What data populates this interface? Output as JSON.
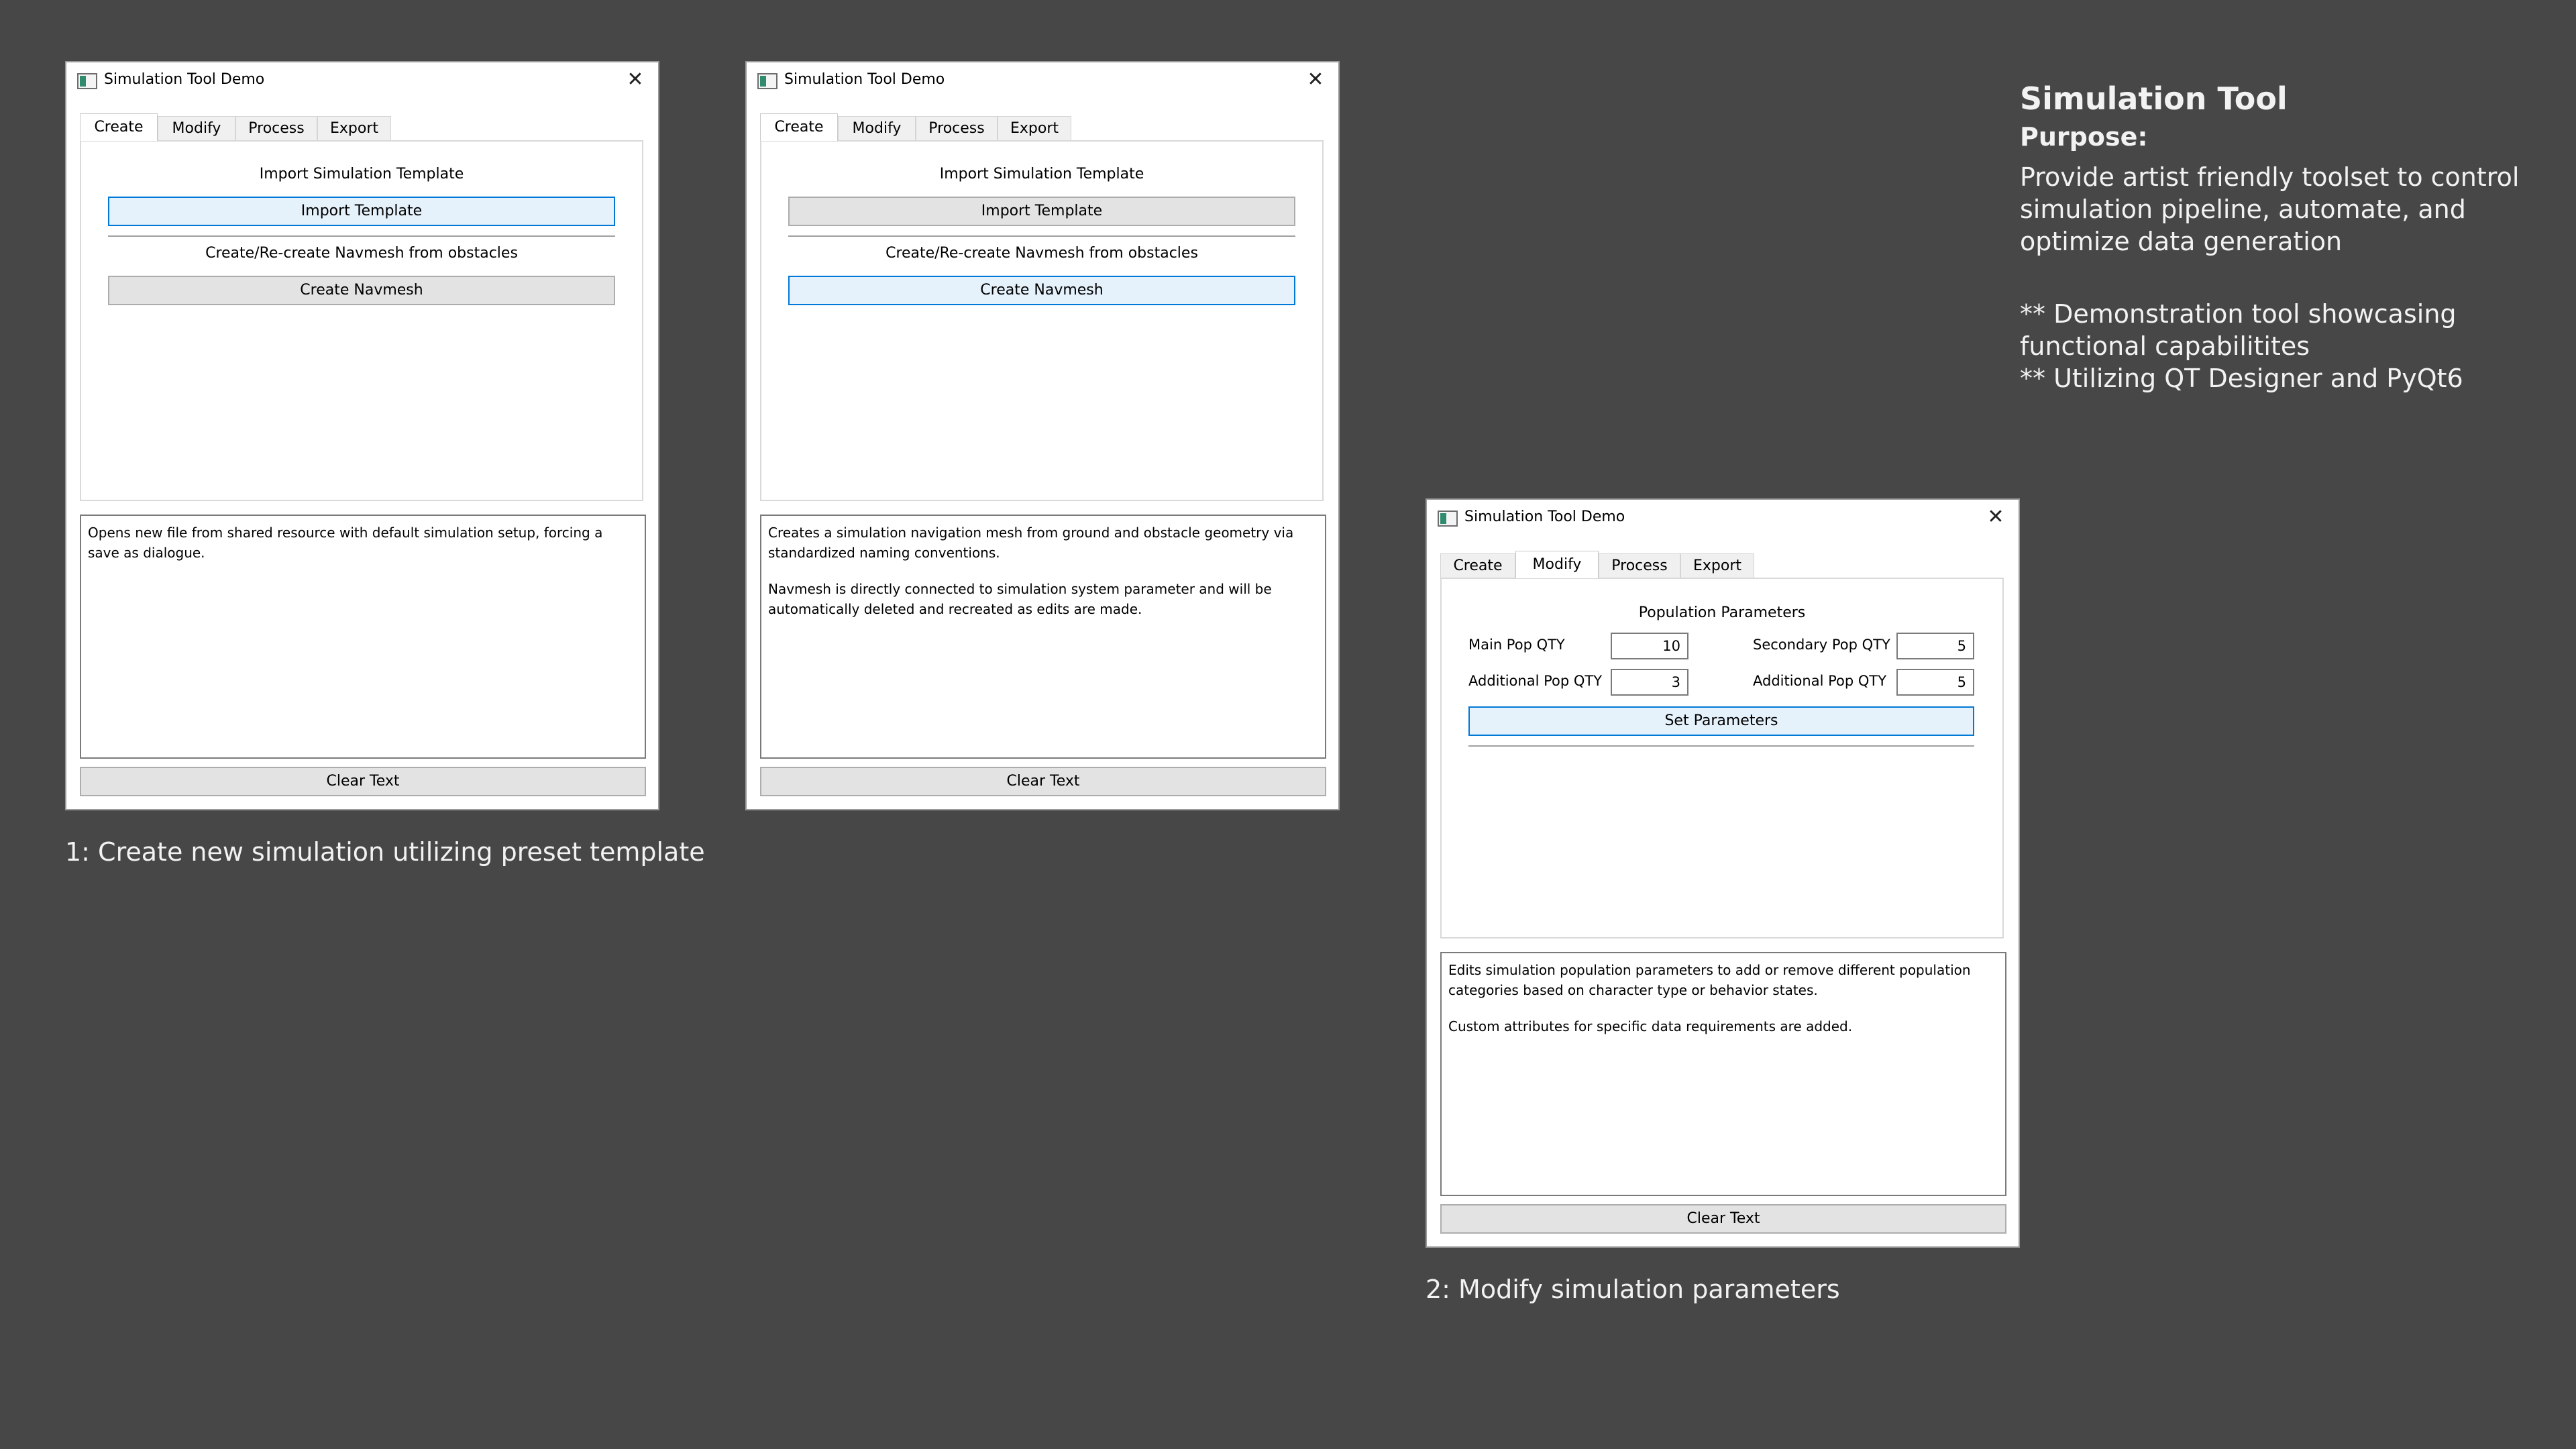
{
  "window_title": "Simulation Tool Demo",
  "tabs": [
    "Create",
    "Modify",
    "Process",
    "Export"
  ],
  "create_tab": {
    "import_heading": "Import Simulation Template",
    "import_button": "Import Template",
    "navmesh_heading": "Create/Re-create Navmesh from obstacles",
    "navmesh_button": "Create Navmesh"
  },
  "modify_tab": {
    "heading": "Population Parameters",
    "main_pop_label": "Main Pop QTY",
    "main_pop_value": "10",
    "secondary_pop_label": "Secondary Pop QTY",
    "secondary_pop_value": "5",
    "additional_pop_label_left": "Additional Pop QTY",
    "additional_pop_value_left": "3",
    "additional_pop_label_right": "Additional Pop QTY",
    "additional_pop_value_right": "5",
    "set_button": "Set Parameters"
  },
  "clear_button": "Clear Text",
  "descriptions": {
    "import": "Opens new file from shared resource with default simulation setup, forcing a\nsave as dialogue.",
    "navmesh_p1": "Creates a simulation navigation mesh from ground and obstacle geometry via\nstandardized naming conventions.",
    "navmesh_p2": "Navmesh is directly connected to simulation system parameter and will be\nautomatically deleted and recreated as edits are made.",
    "modify_p1": "Edits simulation population parameters to add or remove different population\ncategories based on character type or behavior states.",
    "modify_p2": "Custom attributes for specific data requirements are added."
  },
  "captions": {
    "step1": "1: Create new simulation utilizing preset template",
    "step2": "2: Modify simulation parameters"
  },
  "info": {
    "title": "Simulation Tool",
    "purpose_label": "Purpose:",
    "purpose_text": "Provide artist friendly toolset to control\nsimulation pipeline, automate, and\noptimize data generation",
    "notes": "** Demonstration tool showcasing\nfunctional capabilitites\n** Utilizing QT Designer and PyQt6"
  },
  "colors": {
    "background": "#474747",
    "focus_border": "#0078d7",
    "focus_fill": "#e5f1fb",
    "button_fill": "#e3e3e3"
  }
}
